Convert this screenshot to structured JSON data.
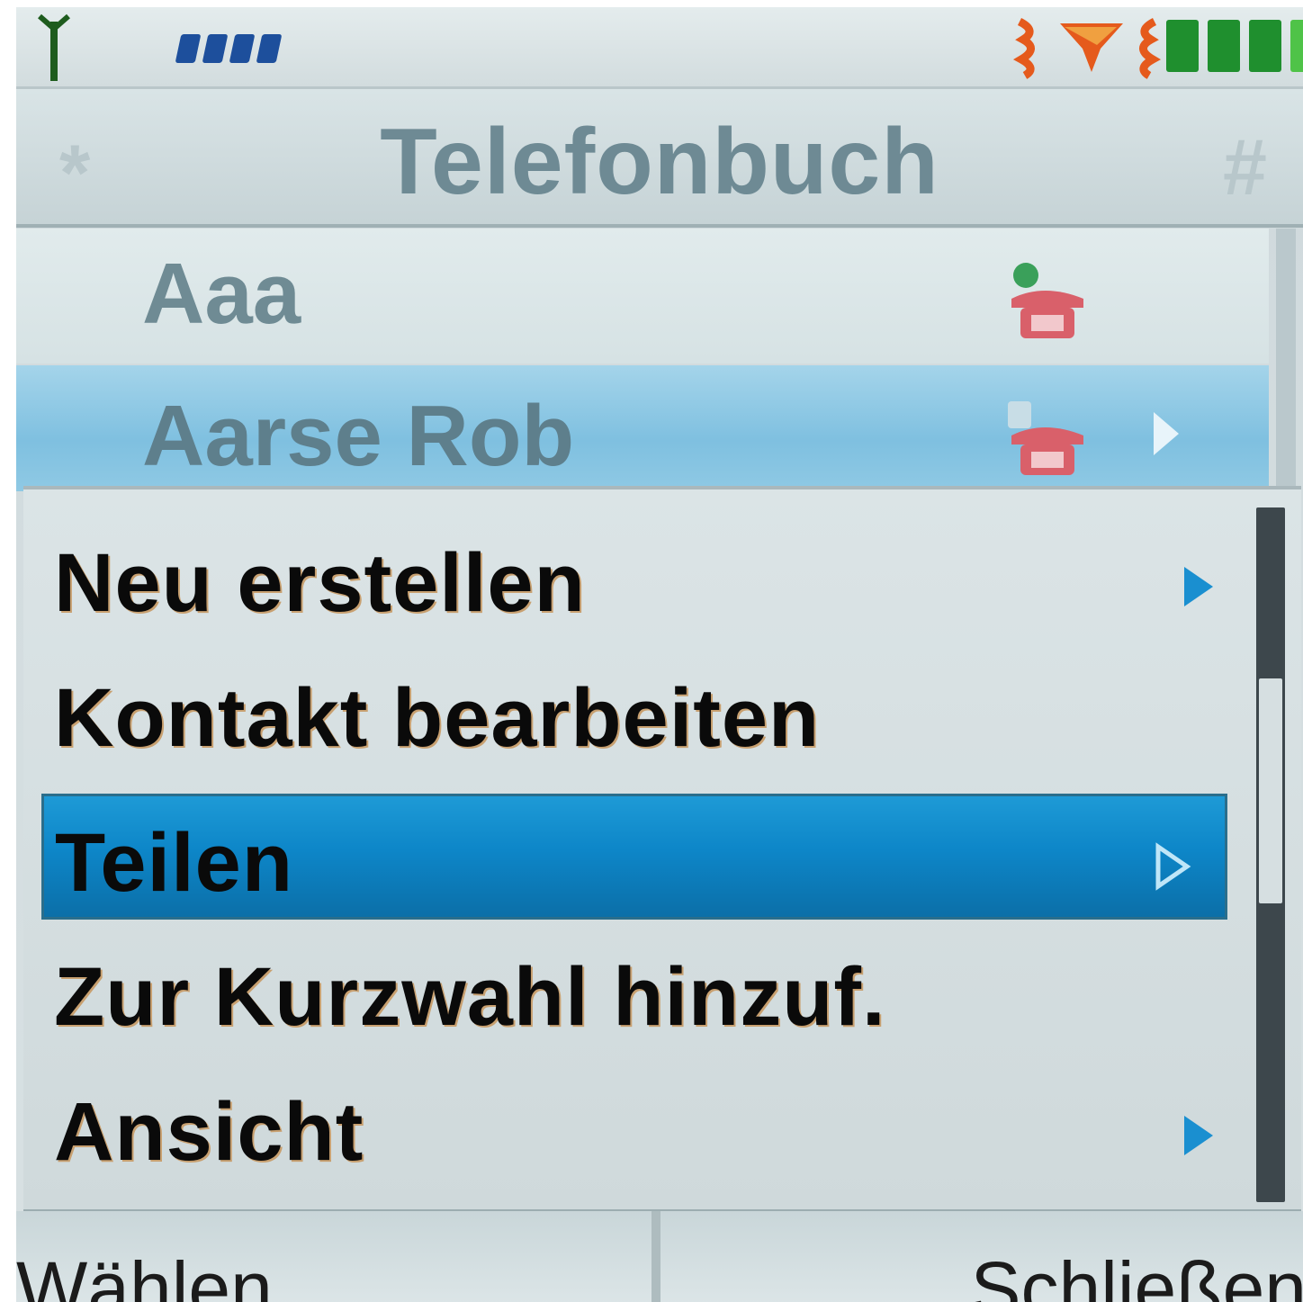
{
  "status_bar": {
    "icons": [
      "antenna-icon",
      "signal-strength-icon",
      "alarm-clock-icon",
      "battery-icon"
    ],
    "colors": {
      "signal": "#1d4f9c",
      "battery": "#1f8f2e",
      "alarm": "#e55a1c"
    }
  },
  "header": {
    "title": "Telefonbuch",
    "left_key": "*",
    "right_key": "#"
  },
  "contacts": [
    {
      "name": "Aaa",
      "icon": "phone-icon",
      "selected": false
    },
    {
      "name": "Aarse Rob",
      "icon": "phone-icon",
      "selected": true
    }
  ],
  "menu": {
    "items": [
      {
        "label": "Neu erstellen",
        "has_submenu": true
      },
      {
        "label": "Kontakt bearbeiten",
        "has_submenu": false
      },
      {
        "label": "Teilen",
        "has_submenu": true,
        "selected": true
      },
      {
        "label": "Zur Kurzwahl hinzuf.",
        "has_submenu": false
      },
      {
        "label": "Ansicht",
        "has_submenu": true
      }
    ],
    "accent_color": "#1a8fd0"
  },
  "softkeys": {
    "left": "Wählen",
    "right": "Schließen"
  }
}
